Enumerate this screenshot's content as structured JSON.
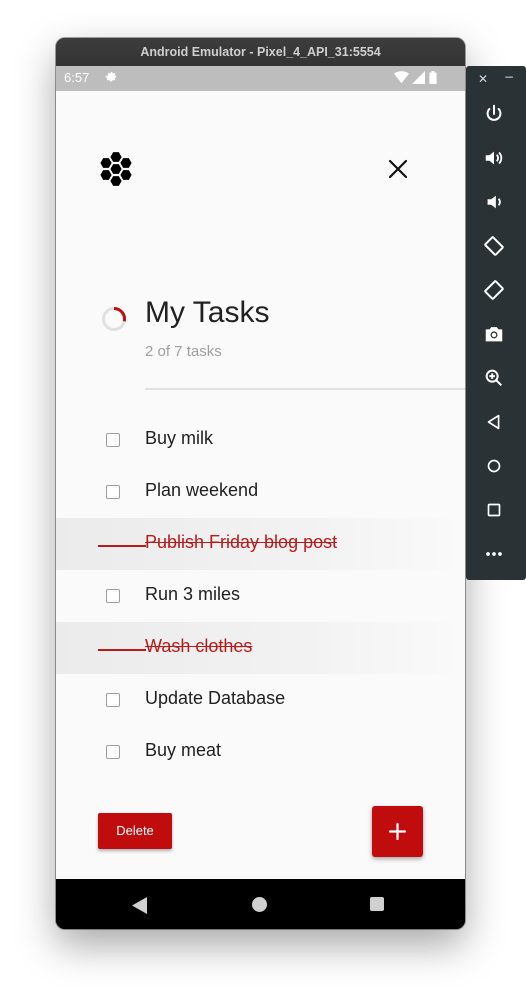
{
  "window": {
    "title": "Android Emulator - Pixel_4_API_31:5554"
  },
  "statusbar": {
    "time": "6:57",
    "icons": [
      "gear-icon",
      "wifi-icon",
      "signal-icon",
      "battery-icon"
    ]
  },
  "app": {
    "title": "My Tasks",
    "subtitle": "2 of 7 tasks",
    "progress_fraction": 0.2857,
    "accent_color": "#c00c0c",
    "tasks": [
      {
        "label": "Buy milk",
        "done": false
      },
      {
        "label": "Plan weekend",
        "done": false
      },
      {
        "label": "Publish Friday blog post",
        "done": true
      },
      {
        "label": "Run 3 miles",
        "done": false
      },
      {
        "label": "Wash clothes",
        "done": true
      },
      {
        "label": "Update Database",
        "done": false
      },
      {
        "label": "Buy meat",
        "done": false
      }
    ],
    "delete_label": "Delete",
    "add_icon": "plus-icon"
  },
  "nav": {
    "icons": [
      "back-icon",
      "home-icon",
      "recents-icon"
    ]
  },
  "sidepanel": {
    "icons": [
      "close-icon",
      "minimize-icon",
      "power-icon",
      "volume-up-icon",
      "volume-down-icon",
      "rotate-left-icon",
      "rotate-right-icon",
      "camera-icon",
      "zoom-icon",
      "back-icon",
      "home-icon",
      "overview-icon",
      "more-icon"
    ]
  }
}
